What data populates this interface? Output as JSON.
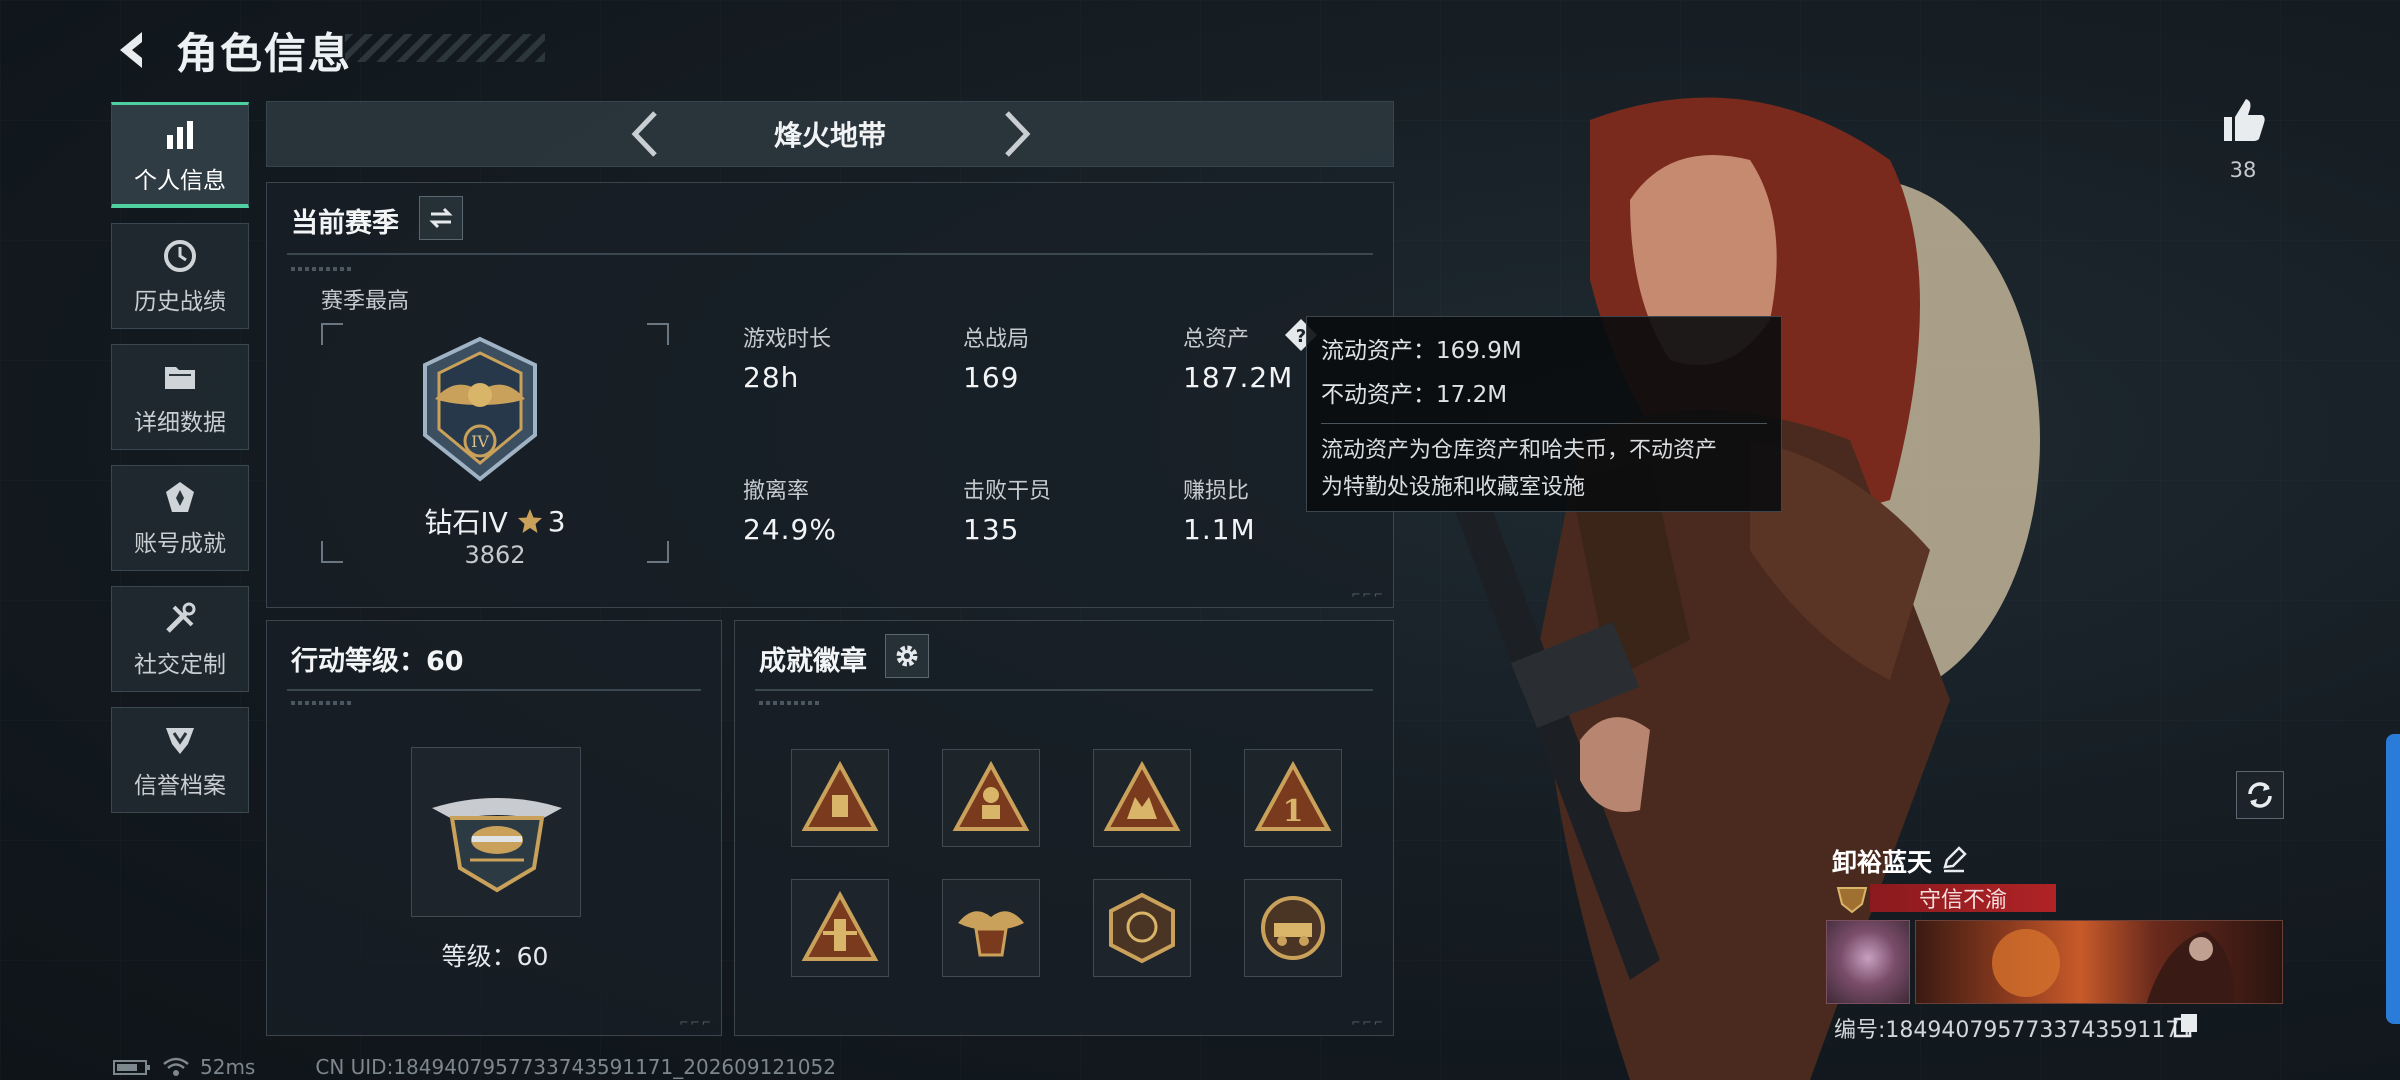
{
  "header": {
    "title": "角色信息"
  },
  "sidebar": {
    "items": [
      {
        "label": "个人信息",
        "icon": "bar-chart-icon",
        "active": true
      },
      {
        "label": "历史战绩",
        "icon": "clock-history-icon"
      },
      {
        "label": "详细数据",
        "icon": "folder-icon"
      },
      {
        "label": "账号成就",
        "icon": "achievement-icon"
      },
      {
        "label": "社交定制",
        "icon": "tools-icon"
      },
      {
        "label": "信誉档案",
        "icon": "shield-badge-icon"
      }
    ]
  },
  "mode": {
    "title": "烽火地带"
  },
  "season": {
    "title": "当前赛季",
    "best_label": "赛季最高",
    "rank_name": "钻石IV",
    "rank_stars": "3",
    "rank_score": "3862",
    "stats": [
      {
        "label": "游戏时长",
        "value": "28h"
      },
      {
        "label": "总战局",
        "value": "169"
      },
      {
        "label": "总资产",
        "value": "187.2M"
      },
      {
        "label": "撤离率",
        "value": "24.9%"
      },
      {
        "label": "击败干员",
        "value": "135"
      },
      {
        "label": "赚损比",
        "value": "1.1M"
      }
    ]
  },
  "tooltip": {
    "liquid": "流动资产：169.9M",
    "fixed": "不动资产：17.2M",
    "desc_line1": "流动资产为仓库资产和哈夫币，不动资产",
    "desc_line2": "为特勤处设施和收藏室设施"
  },
  "action_level": {
    "title": "行动等级：60",
    "level_text": "等级：60"
  },
  "achievements": {
    "title": "成就徽章",
    "badges": [
      "badge-1",
      "badge-2",
      "badge-3",
      "badge-4",
      "badge-5",
      "badge-6",
      "badge-7",
      "badge-8"
    ]
  },
  "player": {
    "likes": "38",
    "name": "卸裕蓝天",
    "reputation": "守信不渝",
    "id_text": "编号:1849407957733743591171"
  },
  "status_bar": {
    "ping": "52ms",
    "uid": "CN UID:1849407957733743591171_202609121052"
  },
  "colors": {
    "accent": "#4ed0a0",
    "reputation": "#b02326",
    "gold": "#c9a15a",
    "side_tab": "#2b7bd8"
  }
}
